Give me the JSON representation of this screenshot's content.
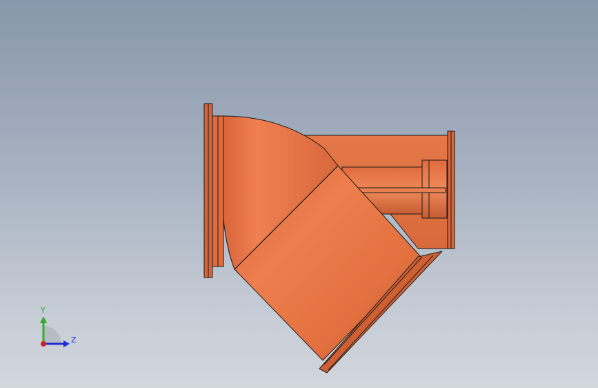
{
  "viewport": {
    "background_top": "#8897ab",
    "background_bottom": "#d2d6dd"
  },
  "model": {
    "part": "y-strainer-body",
    "color": "#e57342",
    "color_shadow": "#b95530",
    "edge_color": "#1a1a1a"
  },
  "triad": {
    "y_label": "Y",
    "z_label": "Z",
    "y_color": "#2fae2f",
    "z_color": "#1b2fd6",
    "x_color": "#d32020"
  }
}
